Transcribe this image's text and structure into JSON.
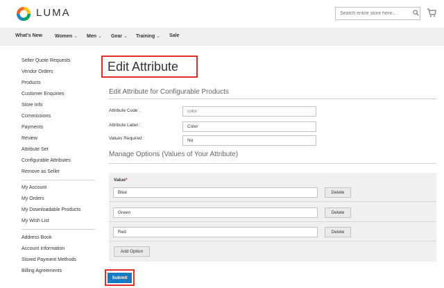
{
  "brand": {
    "name": "LUMA"
  },
  "search": {
    "placeholder": "Search entire store here..."
  },
  "nav": {
    "items": [
      "What's New",
      "Women",
      "Men",
      "Gear",
      "Training",
      "Sale"
    ]
  },
  "sidebar": {
    "group1": [
      "Seller Quote Requests",
      "Vendor Orders",
      "Products",
      "Customer Enquiries",
      "Store Info",
      "Commissions",
      "Payments",
      "Review",
      "Attribute Set",
      "Configurable Attributes",
      "Remove as Seller"
    ],
    "group2": [
      "My Account",
      "My Orders",
      "My Downloadable Products",
      "My Wish List"
    ],
    "group3": [
      "Address Book",
      "Account Information",
      "Stored Payment Methods",
      "Billing Agreements"
    ]
  },
  "page": {
    "title": "Edit Attribute",
    "section1_title": "Edit Attribute for Configurable Products",
    "section2_title": "Manage Options (Values of Your Attribute)"
  },
  "form": {
    "attribute_code_label": "Attribute Code :",
    "attribute_code_placeholder": "color",
    "attribute_label_label": "Attribute Label :",
    "attribute_label_value": "Color",
    "values_required_label": "Values Required :",
    "values_required_value": "No"
  },
  "options": {
    "value_label": "Value",
    "required_mark": "*",
    "rows": [
      "Blue",
      "Green",
      "Red"
    ],
    "delete_label": "Delete",
    "add_option_label": "Add Option"
  },
  "submit_label": "Submit",
  "colors": {
    "accent": "#1979c3",
    "highlight": "#e02b27"
  }
}
